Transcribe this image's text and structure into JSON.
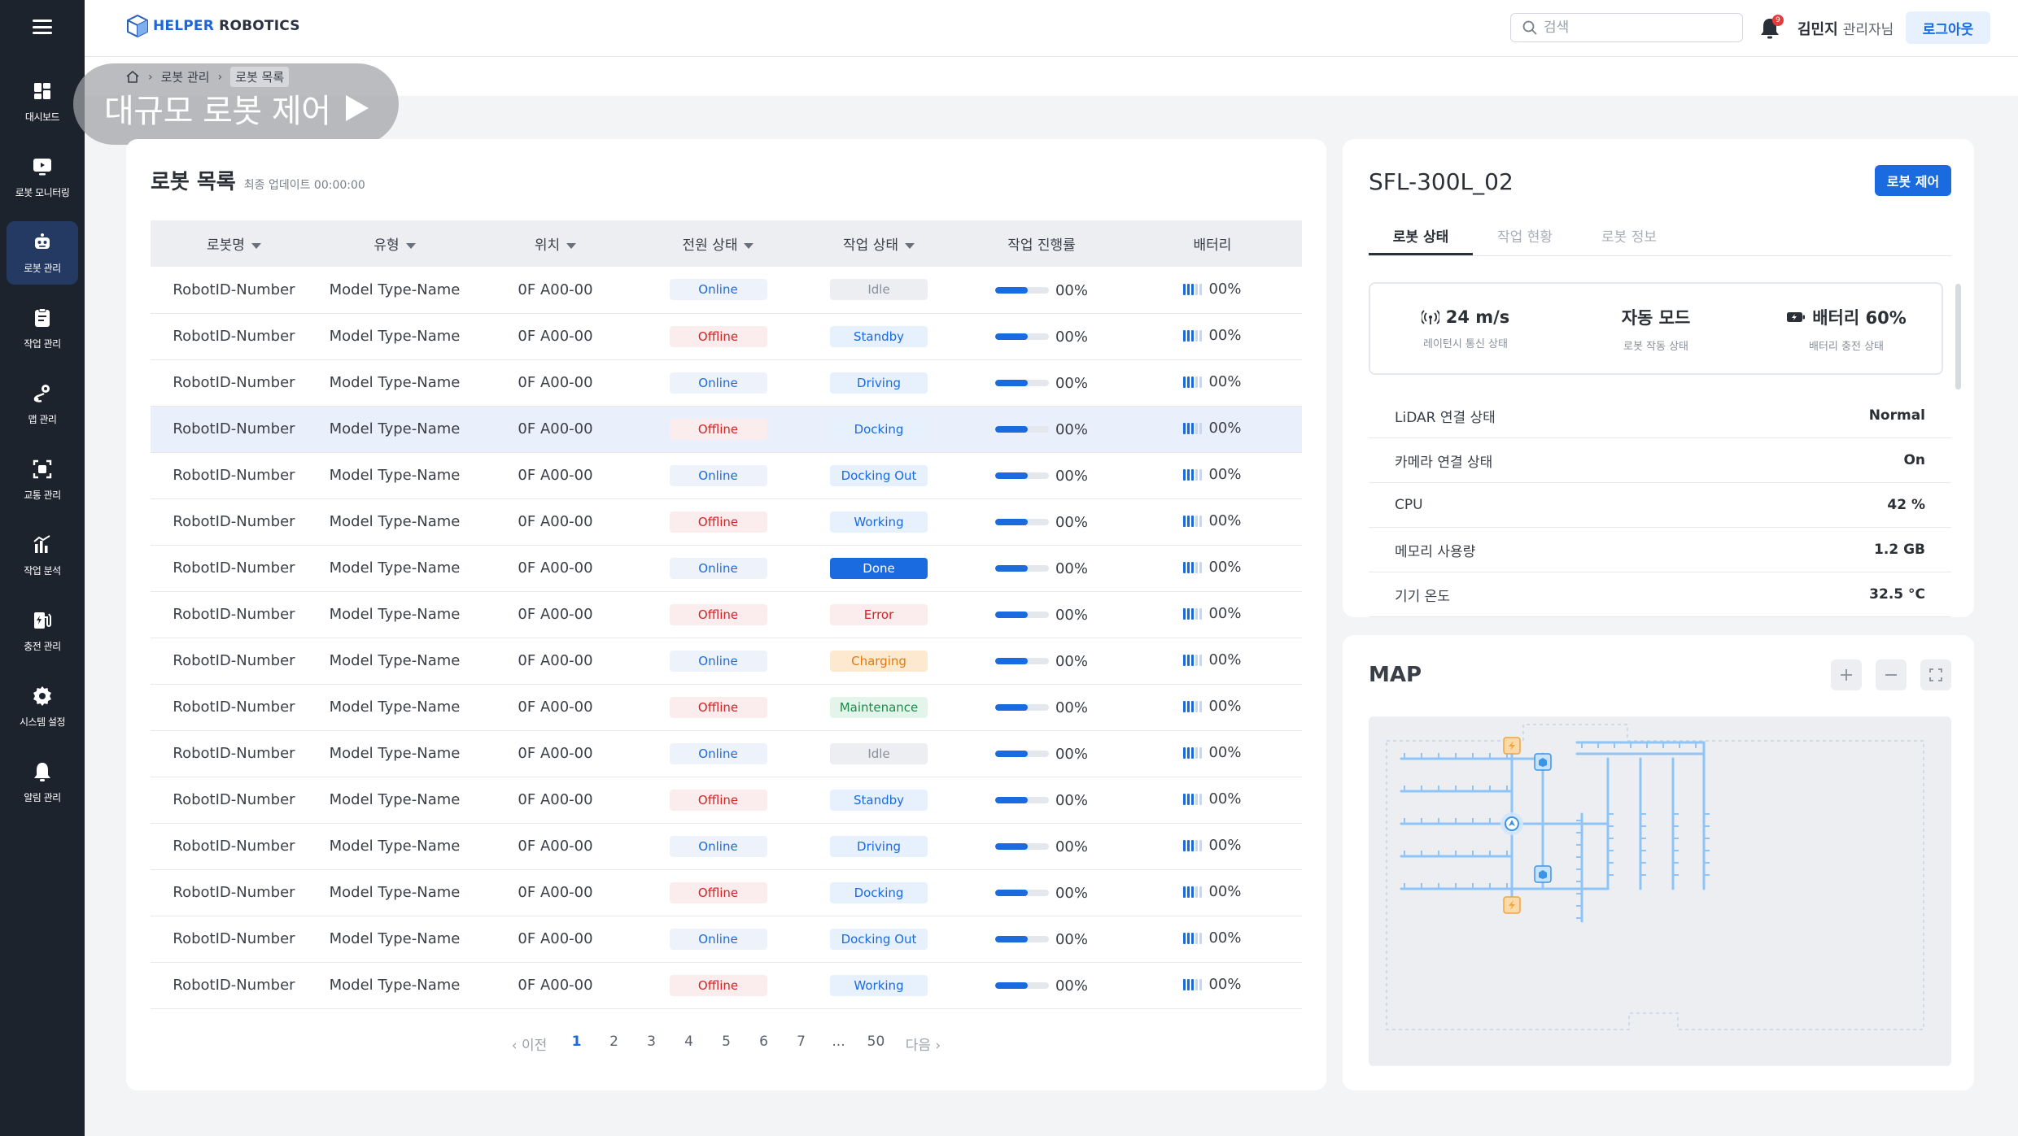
{
  "header": {
    "logo_brand": "HELPER",
    "logo_rest": " ROBOTICS",
    "search_placeholder": "검색",
    "notification_count": "9",
    "user_name": "김민지",
    "user_role": "관리자님",
    "logout_label": "로그아웃"
  },
  "sidebar": {
    "items": [
      {
        "label": "대시보드",
        "icon": "dashboard-icon"
      },
      {
        "label": "로봇 모니터링",
        "icon": "monitor-icon"
      },
      {
        "label": "로봇 관리",
        "icon": "robot-icon"
      },
      {
        "label": "작업 관리",
        "icon": "clipboard-icon"
      },
      {
        "label": "맵 관리",
        "icon": "map-pin-icon"
      },
      {
        "label": "교통 관리",
        "icon": "traffic-icon"
      },
      {
        "label": "작업 분석",
        "icon": "chart-icon"
      },
      {
        "label": "충전 관리",
        "icon": "charger-icon"
      },
      {
        "label": "시스템 설정",
        "icon": "gear-icon"
      },
      {
        "label": "알림 관리",
        "icon": "bell-icon"
      }
    ],
    "active_index": 2
  },
  "breadcrumb": {
    "level1": "로봇 관리",
    "current": "로봇 목록"
  },
  "page_title": "대규모 로봇 제어",
  "robot_list": {
    "title": "로봇 목록",
    "last_update": "최종 업데이트 00:00:00",
    "columns": [
      "로봇명",
      "유형",
      "위치",
      "전원 상태",
      "작업 상태",
      "작업 진행률",
      "배터리"
    ],
    "sortable": [
      true,
      true,
      true,
      true,
      true,
      false,
      false
    ],
    "rows": [
      {
        "name": "RobotID-Number",
        "type": "Model Type-Name",
        "loc": "0F A00-00",
        "power": "Online",
        "work": "Idle",
        "progress": "00%",
        "battery": "00%"
      },
      {
        "name": "RobotID-Number",
        "type": "Model Type-Name",
        "loc": "0F A00-00",
        "power": "Offline",
        "work": "Standby",
        "progress": "00%",
        "battery": "00%"
      },
      {
        "name": "RobotID-Number",
        "type": "Model Type-Name",
        "loc": "0F A00-00",
        "power": "Online",
        "work": "Driving",
        "progress": "00%",
        "battery": "00%"
      },
      {
        "name": "RobotID-Number",
        "type": "Model Type-Name",
        "loc": "0F A00-00",
        "power": "Offline",
        "work": "Docking",
        "progress": "00%",
        "battery": "00%"
      },
      {
        "name": "RobotID-Number",
        "type": "Model Type-Name",
        "loc": "0F A00-00",
        "power": "Online",
        "work": "Docking Out",
        "progress": "00%",
        "battery": "00%"
      },
      {
        "name": "RobotID-Number",
        "type": "Model Type-Name",
        "loc": "0F A00-00",
        "power": "Offline",
        "work": "Working",
        "progress": "00%",
        "battery": "00%"
      },
      {
        "name": "RobotID-Number",
        "type": "Model Type-Name",
        "loc": "0F A00-00",
        "power": "Online",
        "work": "Done",
        "progress": "00%",
        "battery": "00%"
      },
      {
        "name": "RobotID-Number",
        "type": "Model Type-Name",
        "loc": "0F A00-00",
        "power": "Offline",
        "work": "Error",
        "progress": "00%",
        "battery": "00%"
      },
      {
        "name": "RobotID-Number",
        "type": "Model Type-Name",
        "loc": "0F A00-00",
        "power": "Online",
        "work": "Charging",
        "progress": "00%",
        "battery": "00%"
      },
      {
        "name": "RobotID-Number",
        "type": "Model Type-Name",
        "loc": "0F A00-00",
        "power": "Offline",
        "work": "Maintenance",
        "progress": "00%",
        "battery": "00%"
      },
      {
        "name": "RobotID-Number",
        "type": "Model Type-Name",
        "loc": "0F A00-00",
        "power": "Online",
        "work": "Idle",
        "progress": "00%",
        "battery": "00%"
      },
      {
        "name": "RobotID-Number",
        "type": "Model Type-Name",
        "loc": "0F A00-00",
        "power": "Offline",
        "work": "Standby",
        "progress": "00%",
        "battery": "00%"
      },
      {
        "name": "RobotID-Number",
        "type": "Model Type-Name",
        "loc": "0F A00-00",
        "power": "Online",
        "work": "Driving",
        "progress": "00%",
        "battery": "00%"
      },
      {
        "name": "RobotID-Number",
        "type": "Model Type-Name",
        "loc": "0F A00-00",
        "power": "Offline",
        "work": "Docking",
        "progress": "00%",
        "battery": "00%"
      },
      {
        "name": "RobotID-Number",
        "type": "Model Type-Name",
        "loc": "0F A00-00",
        "power": "Online",
        "work": "Docking Out",
        "progress": "00%",
        "battery": "00%"
      },
      {
        "name": "RobotID-Number",
        "type": "Model Type-Name",
        "loc": "0F A00-00",
        "power": "Offline",
        "work": "Working",
        "progress": "00%",
        "battery": "00%"
      }
    ],
    "selected_row": 3,
    "progress_fill": 0.6,
    "battery_level": 0.6
  },
  "pagination": {
    "prev": "‹ 이전",
    "pages": [
      "1",
      "2",
      "3",
      "4",
      "5",
      "6",
      "7",
      "...",
      "50"
    ],
    "next": "다음 ›",
    "current": "1"
  },
  "robot_detail": {
    "name": "SFL-300L_02",
    "control_label": "로봇 제어",
    "tabs": [
      "로봇 상태",
      "작업 현황",
      "로봇 정보"
    ],
    "active_tab": 0,
    "stats": [
      {
        "icon": "signal-icon",
        "value": "24 m/s",
        "label": "레이턴시 통신 상태"
      },
      {
        "icon": "",
        "value": "자동 모드",
        "label": "로봇 작동 상태"
      },
      {
        "icon": "battery-icon",
        "value": "배터리 60%",
        "label": "배터리 충전 상태"
      }
    ],
    "info": [
      {
        "key": "LiDAR 연결 상태",
        "value": "Normal"
      },
      {
        "key": "카메라 연결 상태",
        "value": "On"
      },
      {
        "key": "CPU",
        "value": "42 %"
      },
      {
        "key": "메모리 사용량",
        "value": "1.2 GB"
      },
      {
        "key": "기기 온도",
        "value": "32.5 °C"
      }
    ]
  },
  "map": {
    "title": "MAP",
    "track_color": "#8ec4f6",
    "track_dark": "#3c94e8"
  },
  "colors": {
    "primary": "#1b6be0",
    "sidebar_bg": "#1d232d",
    "sidebar_active": "#243a63",
    "online_text": "#1b6be0",
    "online_bg": "#eef3fb",
    "offline_text": "#d32424",
    "offline_bg": "#fbeded",
    "status": {
      "Idle": {
        "fg": "#8a9099",
        "bg": "#eceef1"
      },
      "Standby": {
        "fg": "#1b6be0",
        "bg": "#e7f0fd"
      },
      "Driving": {
        "fg": "#1b6be0",
        "bg": "#e7f0fd"
      },
      "Docking": {
        "fg": "#1b6be0",
        "bg": "#e7f0fd"
      },
      "Docking Out": {
        "fg": "#1b6be0",
        "bg": "#e7f0fd"
      },
      "Working": {
        "fg": "#1b6be0",
        "bg": "#e7f0fd"
      },
      "Done": {
        "fg": "#ffffff",
        "bg": "#1b6be0"
      },
      "Error": {
        "fg": "#d32424",
        "bg": "#fbeded"
      },
      "Charging": {
        "fg": "#e07a10",
        "bg": "#fde9cf"
      },
      "Maintenance": {
        "fg": "#1e8a4a",
        "bg": "#e3f5ea"
      }
    }
  }
}
